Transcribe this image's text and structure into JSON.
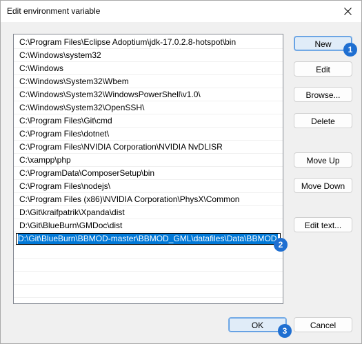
{
  "window": {
    "title": "Edit environment variable"
  },
  "list": {
    "items": [
      "C:\\Program Files\\Eclipse Adoptium\\jdk-17.0.2.8-hotspot\\bin",
      "C:\\Windows\\system32",
      "C:\\Windows",
      "C:\\Windows\\System32\\Wbem",
      "C:\\Windows\\System32\\WindowsPowerShell\\v1.0\\",
      "C:\\Windows\\System32\\OpenSSH\\",
      "C:\\Program Files\\Git\\cmd",
      "C:\\Program Files\\dotnet\\",
      "C:\\Program Files\\NVIDIA Corporation\\NVIDIA NvDLISR",
      "C:\\xampp\\php",
      "C:\\ProgramData\\ComposerSetup\\bin",
      "C:\\Program Files\\nodejs\\",
      "C:\\Program Files (x86)\\NVIDIA Corporation\\PhysX\\Common",
      "D:\\Git\\kraifpatrik\\Xpanda\\dist",
      "D:\\Git\\BlueBurn\\GMDoc\\dist"
    ],
    "editing_value": "D:\\Git\\BlueBurn\\BBMOD-master\\BBMOD_GML\\datafiles\\Data\\BBMOD"
  },
  "buttons": {
    "new": "New",
    "edit": "Edit",
    "browse": "Browse...",
    "delete": "Delete",
    "move_up": "Move Up",
    "move_down": "Move Down",
    "edit_text": "Edit text...",
    "ok": "OK",
    "cancel": "Cancel"
  },
  "badges": {
    "one": "1",
    "two": "2",
    "three": "3"
  },
  "colors": {
    "accent": "#1f6fd1",
    "selection": "#0078d7"
  }
}
